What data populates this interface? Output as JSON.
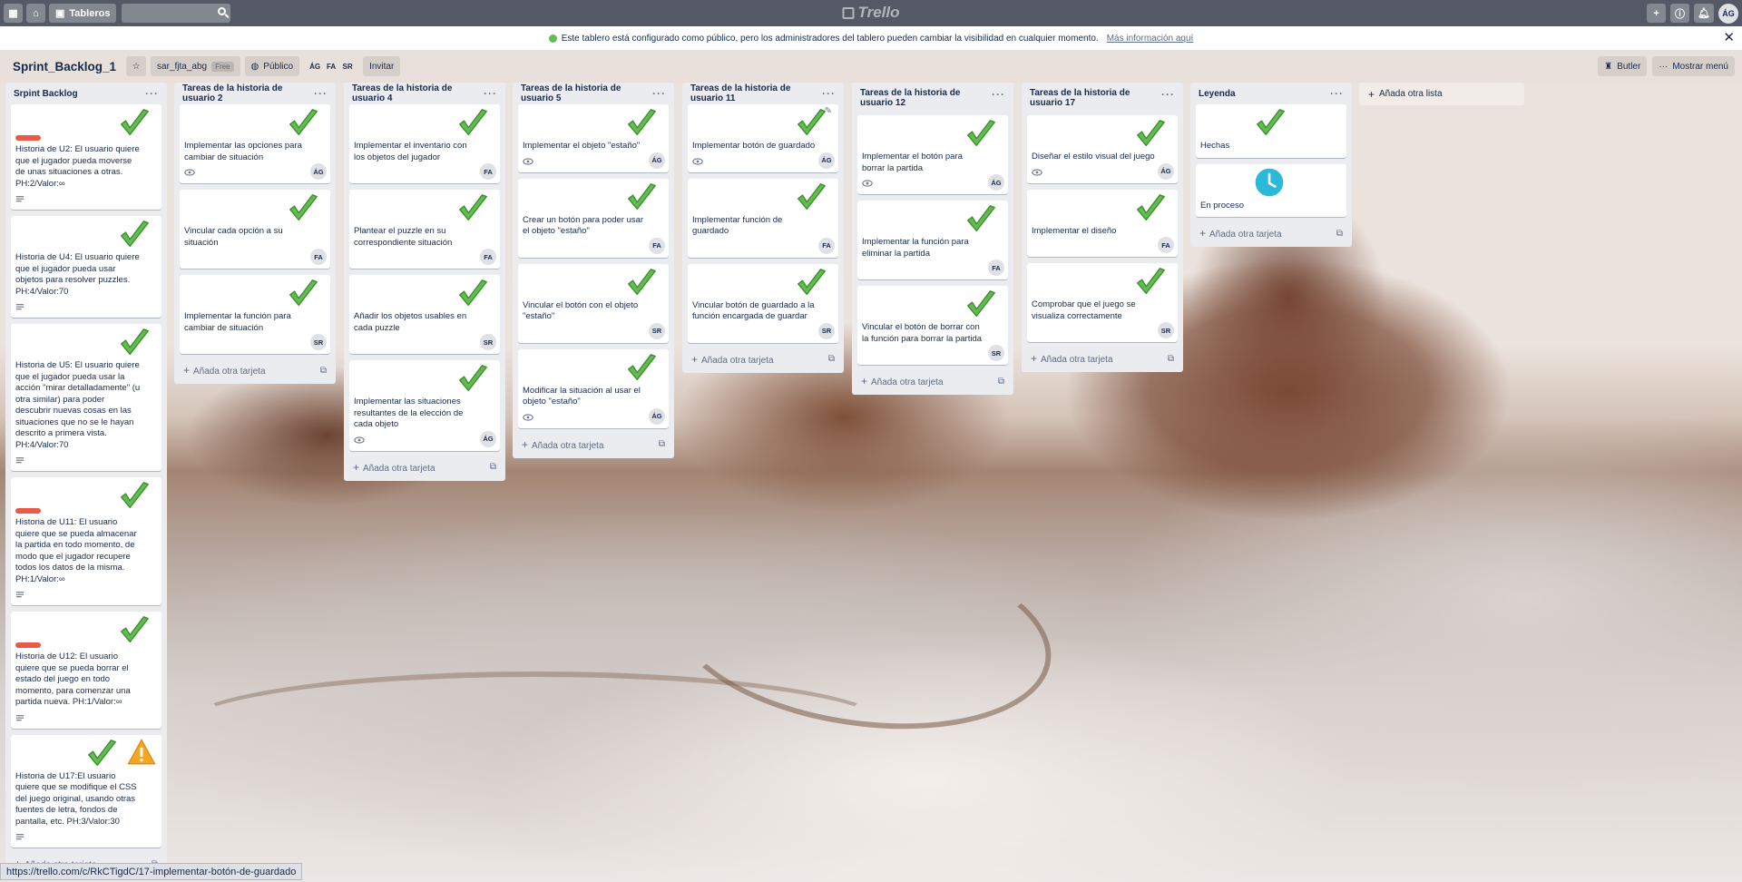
{
  "topbar": {
    "boards_label": "Tableros",
    "search_placeholder": "",
    "logo_text": "Trello",
    "user_initials": "ÁG"
  },
  "banner": {
    "text": "Este tablero está configurado como público, pero los administradores del tablero pueden cambiar la visibilidad en cualquier momento.",
    "link": "Más información aquí"
  },
  "board_header": {
    "title": "Sprint_Backlog_1",
    "team": "sar_fjta_abg",
    "team_badge": "Free",
    "visibility": "Público",
    "members": [
      "ÁG",
      "FA",
      "SR"
    ],
    "invite_label": "Invitar",
    "butler_label": "Butler",
    "menu_label": "Mostrar menú"
  },
  "lists": [
    {
      "title": "Srpint Backlog",
      "cards": [
        {
          "title": "Historia de U2: El usuario quiere que el jugador pueda moverse de unas situaciones a otras. PH:2/Valor:∞",
          "label": true
        },
        {
          "title": "Historia de U4: El usuario quiere que el jugador pueda usar objetos para resolver puzzles. PH:4/Valor:70"
        },
        {
          "title": "Historia de U5: El usuario quiere que el jugador pueda usar la acción \"mirar detalladamente\" (u otra similar) para poder descubrir nuevas cosas en las situaciones que no se le hayan descrito a primera vista. PH:4/Valor:70"
        },
        {
          "title": "Historia de U11: El usuario quiere que se pueda almacenar la partida en todo momento, de modo que el jugador recupere todos los datos de la misma. PH:1/Valor:∞",
          "label": true
        },
        {
          "title": "Historia de U12: El usuario quiere que se pueda borrar el estado del juego en todo momento, para comenzar una partida nueva. PH:1/Valor:∞",
          "label": true
        },
        {
          "title": "Historia de U17:El usuario quiere que se modifique el CSS del juego original, usando otras fuentes de letra, fondos de pantalla, etc. PH:3/Valor:30"
        }
      ],
      "add_card": "Añada otra tarjeta"
    },
    {
      "title": "Tareas de la historia de usuario 2",
      "cards": [
        {
          "title": "Implementar las opciones para cambiar de situación",
          "member": "ÁG"
        },
        {
          "title": "Vincular cada opción a su situación",
          "member": "FA"
        },
        {
          "title": "Implementar la función para cambiar de situación",
          "member": "SR"
        }
      ],
      "add_card": "Añada otra tarjeta"
    },
    {
      "title": "Tareas de la historia de usuario 4",
      "cards": [
        {
          "title": "Implementar el inventario con los objetos del jugador",
          "member": "FA"
        },
        {
          "title": "Plantear el puzzle en su correspondiente situación",
          "member": "FA"
        },
        {
          "title": "Añadir los objetos usables en cada puzzle",
          "member": "SR"
        },
        {
          "title": "Implementar las situaciones resultantes de la elección de cada objeto",
          "member": "ÁG"
        }
      ],
      "add_card": "Añada otra tarjeta"
    },
    {
      "title": "Tareas de la historia de usuario 5",
      "cards": [
        {
          "title": "Implementar el objeto \"estaño\"",
          "member": "ÁG"
        },
        {
          "title": "Crear un botón para poder usar el objeto \"estaño\"",
          "member": "FA"
        },
        {
          "title": "Vincular el botón con el objeto \"estaño\"",
          "member": "SR"
        },
        {
          "title": "Modificar la situación al usar el objeto \"estaño\"",
          "member": "ÁG"
        }
      ],
      "add_card": "Añada otra tarjeta"
    },
    {
      "title": "Tareas de la historia de usuario 11",
      "cards": [
        {
          "title": "Implementar botón de guardado",
          "member": "ÁG"
        },
        {
          "title": "Implementar función de guardado",
          "member": "FA"
        },
        {
          "title": "Vincular botón de guardado a la función encargada de guardar",
          "member": "SR"
        }
      ],
      "add_card": "Añada otra tarjeta"
    },
    {
      "title": "Tareas de la historia de usuario 12",
      "cards": [
        {
          "title": "Implementar el botón para borrar la partida",
          "member": "ÁG"
        },
        {
          "title": "Implementar la función para eliminar la partida",
          "member": "FA"
        },
        {
          "title": "Vincular el botón de borrar con la función para borrar la partida",
          "member": "SR"
        }
      ],
      "add_card": "Añada otra tarjeta"
    },
    {
      "title": "Tareas de la historia de usuario 17",
      "cards": [
        {
          "title": "Diseñar el estilo visual del juego",
          "member": "ÁG"
        },
        {
          "title": "Implementar el diseño",
          "member": "FA"
        },
        {
          "title": "Comprobar que el juego se visualiza correctamente",
          "member": "SR"
        }
      ],
      "add_card": "Añada otra tarjeta"
    },
    {
      "title": "Leyenda",
      "cards": [
        {
          "title": "Hechas"
        },
        {
          "title": "En proceso"
        }
      ],
      "add_card": "Añada otra tarjeta"
    }
  ],
  "add_list": "Añada otra lista",
  "status_url": "https://trello.com/c/RkCTigdC/17-implementar-botón-de-guardado",
  "colors": {
    "topbar": "#3f4654",
    "card_label_red": "#eb5a46",
    "check_green": "#61bd4f",
    "clock_blue": "#2ab9d8",
    "warning_orange": "#f5a623"
  }
}
